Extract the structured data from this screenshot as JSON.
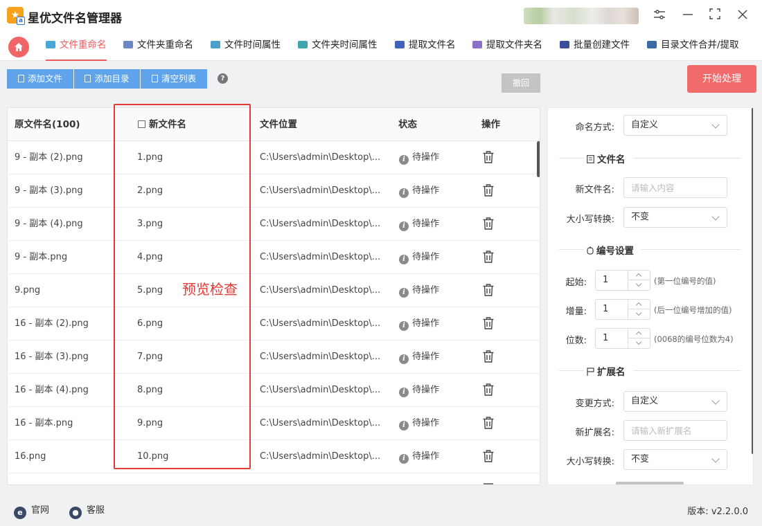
{
  "app": {
    "title": "星优文件名管理器",
    "logo_letter": "a"
  },
  "nav": {
    "tabs": [
      {
        "label": "文件重命名",
        "active": true,
        "icon": "file-rename-icon",
        "color": "#48a8d8"
      },
      {
        "label": "文件夹重命名",
        "active": false,
        "icon": "folder-rename-icon",
        "color": "#6b88c2"
      },
      {
        "label": "文件时间属性",
        "active": false,
        "icon": "file-time-icon",
        "color": "#4aa0c8"
      },
      {
        "label": "文件夹时间属性",
        "active": false,
        "icon": "folder-time-icon",
        "color": "#3fa6b0"
      },
      {
        "label": "提取文件名",
        "active": false,
        "icon": "extract-filename-icon",
        "color": "#3f63b8"
      },
      {
        "label": "提取文件夹名",
        "active": false,
        "icon": "extract-foldername-icon",
        "color": "#8c6fc8"
      },
      {
        "label": "批量创建文件",
        "active": false,
        "icon": "batch-create-icon",
        "color": "#3b4f9c"
      },
      {
        "label": "目录文件合并/提取",
        "active": false,
        "icon": "merge-extract-icon",
        "color": "#3a6aa8"
      }
    ]
  },
  "toolbar": {
    "add_file": "添加文件",
    "add_dir": "添加目录",
    "clear_list": "清空列表",
    "help": "?",
    "undo": "撤回",
    "start": "开始处理"
  },
  "table": {
    "headers": {
      "original": "原文件名(100)",
      "new_name": "新文件名",
      "location": "文件位置",
      "status": "状态",
      "action": "操作"
    },
    "rows": [
      {
        "original": "9 - 副本 (2).png",
        "new_name": "1.png",
        "location": "C:\\Users\\admin\\Desktop\\...",
        "status": "待操作"
      },
      {
        "original": "9 - 副本 (3).png",
        "new_name": "2.png",
        "location": "C:\\Users\\admin\\Desktop\\...",
        "status": "待操作"
      },
      {
        "original": "9 - 副本 (4).png",
        "new_name": "3.png",
        "location": "C:\\Users\\admin\\Desktop\\...",
        "status": "待操作"
      },
      {
        "original": "9 - 副本.png",
        "new_name": "4.png",
        "location": "C:\\Users\\admin\\Desktop\\...",
        "status": "待操作"
      },
      {
        "original": "9.png",
        "new_name": "5.png",
        "location": "C:\\Users\\admin\\Desktop\\...",
        "status": "待操作"
      },
      {
        "original": "16 - 副本 (2).png",
        "new_name": "6.png",
        "location": "C:\\Users\\admin\\Desktop\\...",
        "status": "待操作"
      },
      {
        "original": "16 - 副本 (3).png",
        "new_name": "7.png",
        "location": "C:\\Users\\admin\\Desktop\\...",
        "status": "待操作"
      },
      {
        "original": "16 - 副本 (4).png",
        "new_name": "8.png",
        "location": "C:\\Users\\admin\\Desktop\\...",
        "status": "待操作"
      },
      {
        "original": "16 - 副本.png",
        "new_name": "9.png",
        "location": "C:\\Users\\admin\\Desktop\\...",
        "status": "待操作"
      },
      {
        "original": "16.png",
        "new_name": "10.png",
        "location": "C:\\Users\\admin\\Desktop\\...",
        "status": "待操作"
      }
    ],
    "annotation": "预览检查"
  },
  "settings": {
    "naming_mode_label": "命名方式:",
    "naming_mode_value": "自定义",
    "filename_section": "文件名",
    "new_name_label": "新文件名:",
    "new_name_placeholder": "请输入内容",
    "case_label": "大小写转换:",
    "case_value": "不变",
    "numbering_section": "编号设置",
    "start_label": "起始:",
    "start_value": "1",
    "start_hint": "(第一位编号的值)",
    "step_label": "增量:",
    "step_value": "1",
    "step_hint": "(后一位编号增加的值)",
    "digits_label": "位数:",
    "digits_value": "1",
    "digits_hint": "(0068的编号位数为4)",
    "ext_section": "扩展名",
    "ext_mode_label": "变更方式:",
    "ext_mode_value": "自定义",
    "new_ext_label": "新扩展名:",
    "new_ext_placeholder": "请输入新扩展名",
    "ext_case_label": "大小写转换:",
    "ext_case_value": "不变"
  },
  "footer": {
    "website": "官网",
    "support": "客服",
    "version_label": "版本:",
    "version": "v2.2.0.0"
  }
}
